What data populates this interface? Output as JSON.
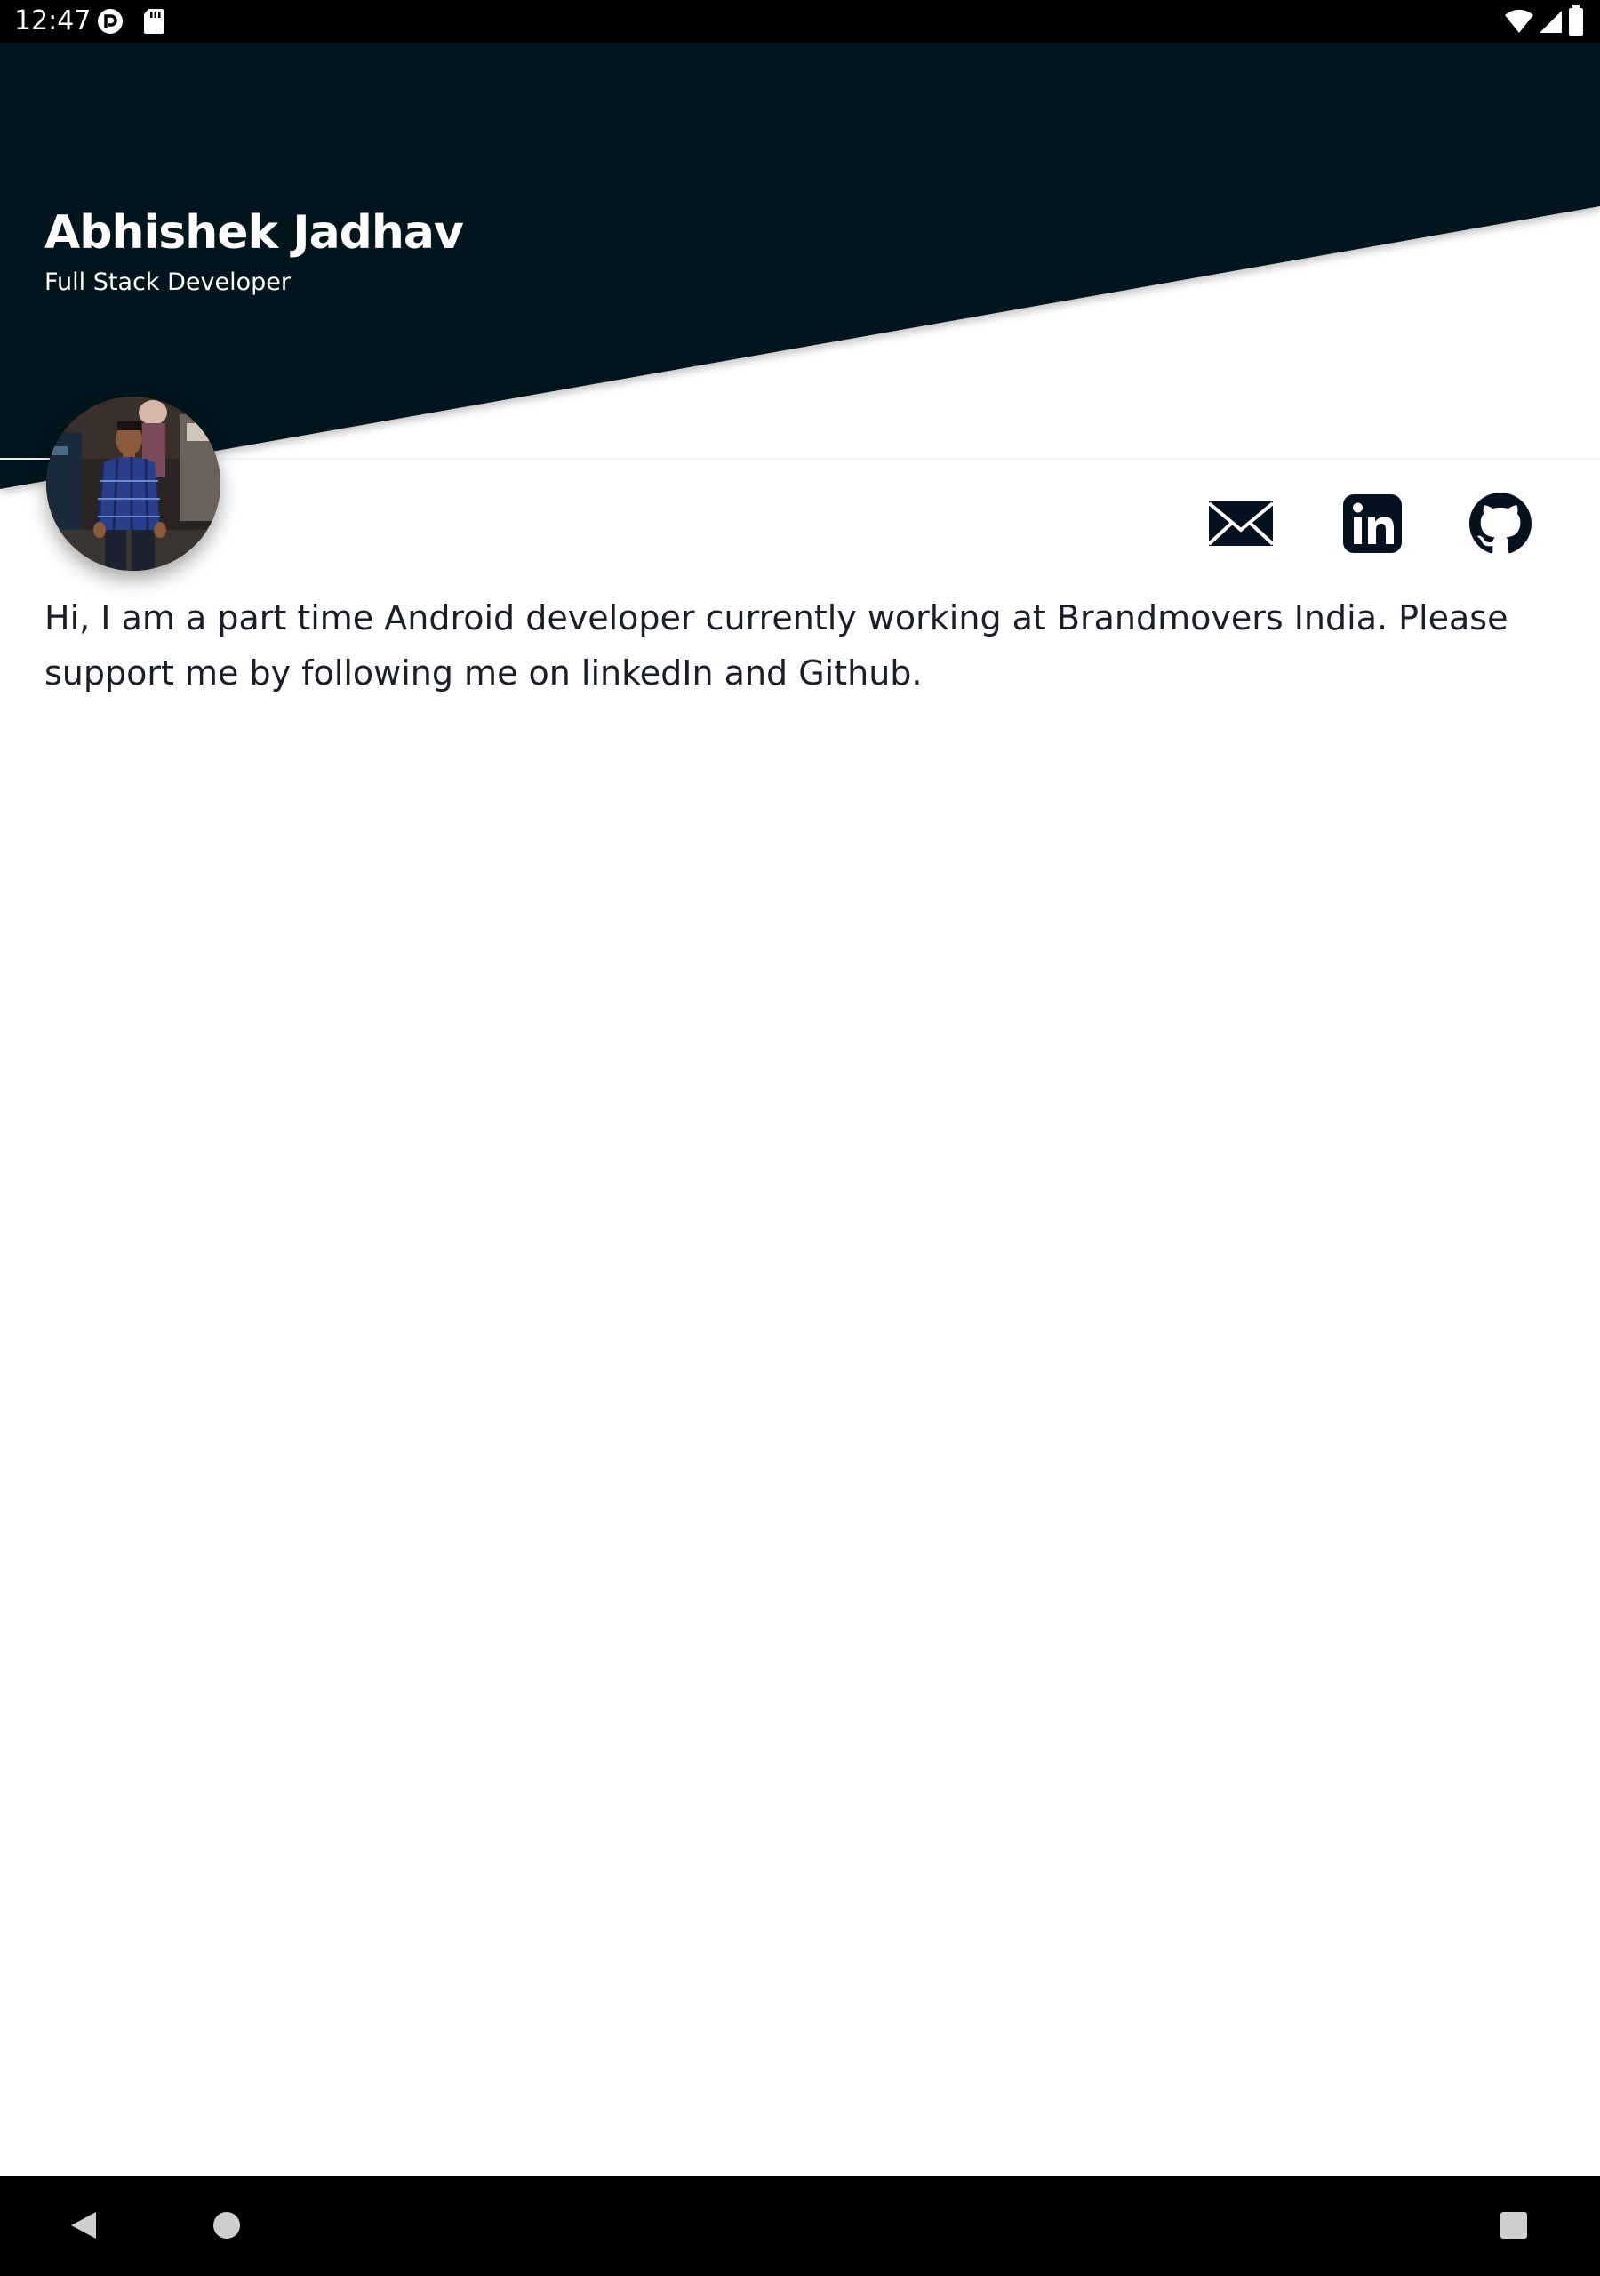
{
  "status_bar": {
    "time": "12:47",
    "left_icons": [
      "pocket-casts-icon",
      "sd-card-icon"
    ],
    "right_icons": [
      "wifi-icon",
      "cell-signal-icon",
      "battery-icon"
    ]
  },
  "profile": {
    "name": "Abhishek Jadhav",
    "role": "Full Stack Developer",
    "avatar_icon": "profile-photo"
  },
  "social_links": [
    {
      "name": "email",
      "icon": "mail-icon"
    },
    {
      "name": "linkedin",
      "icon": "linkedin-icon"
    },
    {
      "name": "github",
      "icon": "github-icon"
    }
  ],
  "bio": "Hi, I am a part time Android developer currently working at Brandmovers India. Please support me by following me on linkedIn and Github.",
  "nav_bar": {
    "buttons": [
      "back-icon",
      "home-icon",
      "recents-icon"
    ]
  },
  "colors": {
    "header_bg": "#04121f",
    "text_dark": "#1a1e26",
    "icon_dark": "#04121f"
  }
}
